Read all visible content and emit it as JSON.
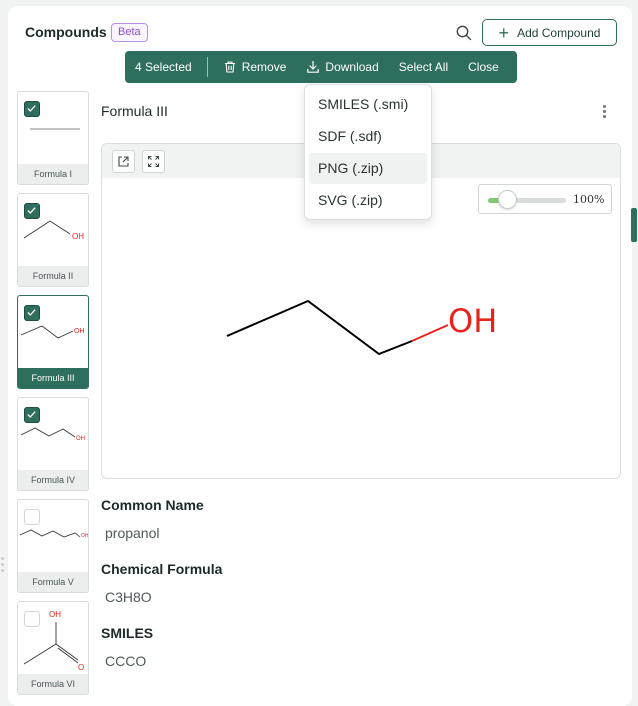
{
  "header": {
    "title": "Compounds",
    "badge": "Beta",
    "add_button_label": "Add Compound"
  },
  "toolbar": {
    "selected_count": "4 Selected",
    "remove_label": "Remove",
    "download_label": "Download",
    "select_all_label": "Select All",
    "close_label": "Close",
    "color": "#2d6e5e"
  },
  "download_menu": {
    "options": [
      "SMILES (.smi)",
      "SDF (.sdf)",
      "PNG (.zip)",
      "SVG (.zip)"
    ],
    "highlighted": "PNG (.zip)"
  },
  "compounds": [
    {
      "label": "Formula I",
      "checked": true,
      "active": false
    },
    {
      "label": "Formula II",
      "checked": true,
      "active": false,
      "atom": "OH"
    },
    {
      "label": "Formula III",
      "checked": true,
      "active": true,
      "atom": "OH"
    },
    {
      "label": "Formula IV",
      "checked": true,
      "active": false,
      "atom": "OH"
    },
    {
      "label": "Formula V",
      "checked": false,
      "active": false,
      "atom": "OH"
    },
    {
      "label": "Formula VI",
      "checked": false,
      "active": false,
      "atom_top": "OH",
      "atom_right": "O"
    }
  ],
  "detail": {
    "title": "Formula III",
    "zoom_percent": "100%",
    "zoom_fraction": 0.25,
    "molecule_atom": "OH",
    "fields": [
      {
        "label": "Common Name",
        "value": "propanol"
      },
      {
        "label": "Chemical Formula",
        "value": "C3H8O"
      },
      {
        "label": "SMILES",
        "value": "CCCO"
      }
    ]
  },
  "colors": {
    "accent": "#2d6e5e",
    "heteroatom": "#e8231b",
    "beta": "#8e4fcf",
    "slider_fill": "#7fca70"
  }
}
